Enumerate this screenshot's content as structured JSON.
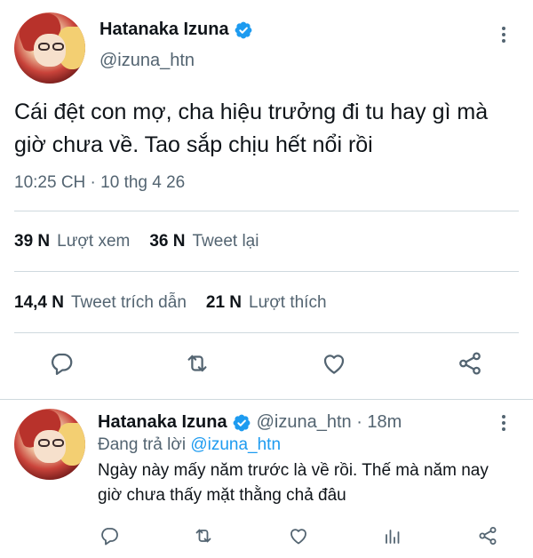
{
  "main_tweet": {
    "author": {
      "display_name": "Hatanaka Izuna",
      "handle": "@izuna_htn",
      "verified": true
    },
    "text": "Cái đệt con mợ, cha hiệu trưởng đi tu hay gì mà giờ chưa về. Tao sắp chịu hết nổi rồi",
    "timestamp": "10:25 CH · 10 thg 4 26",
    "stats": {
      "views_count": "39 N",
      "views_label": "Lượt xem",
      "retweets_count": "36 N",
      "retweets_label": "Tweet lại",
      "quotes_count": "14,4 N",
      "quotes_label": "Tweet trích dẫn",
      "likes_count": "21 N",
      "likes_label": "Lượt thích"
    },
    "actions": [
      "reply-icon",
      "retweet-icon",
      "like-icon",
      "share-icon"
    ]
  },
  "reply_tweet": {
    "author": {
      "display_name": "Hatanaka Izuna",
      "handle": "@izuna_htn",
      "verified": true
    },
    "meta": "@izuna_htn · 18m",
    "replying_prefix": "Đang trả lời",
    "replying_to": "@izuna_htn",
    "text": "Ngày này mấy năm trước là về rồi. Thế mà năm nay giờ chưa thấy mặt thằng chả đâu",
    "actions": [
      "reply-icon",
      "retweet-icon",
      "like-icon",
      "views-icon",
      "share-icon"
    ]
  },
  "colors": {
    "verified_blue": "#1d9bf0",
    "secondary_text": "#536471",
    "divider": "#cfd9de"
  }
}
